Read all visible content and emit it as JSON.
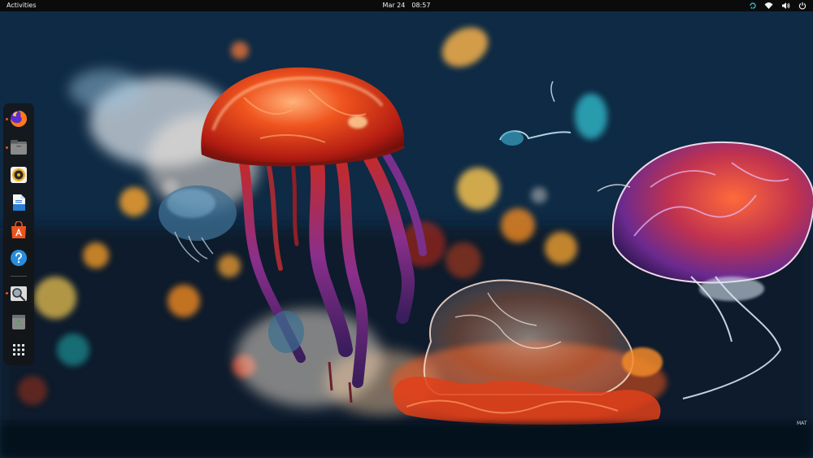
{
  "topbar": {
    "activities_label": "Activities",
    "date": "Mar 24",
    "time": "08:57",
    "tray_icons": [
      "updates-icon",
      "network-icon",
      "volume-icon",
      "power-icon"
    ]
  },
  "dock": {
    "items": [
      {
        "name": "Firefox",
        "icon": "firefox-icon",
        "running": true
      },
      {
        "name": "Files",
        "icon": "files-icon",
        "running": true
      },
      {
        "name": "Rhythmbox",
        "icon": "rhythmbox-icon",
        "running": false
      },
      {
        "name": "LibreOffice Writer",
        "icon": "writer-icon",
        "running": false
      },
      {
        "name": "Ubuntu Software",
        "icon": "software-icon",
        "running": false
      },
      {
        "name": "Help",
        "icon": "help-icon",
        "running": false
      },
      {
        "name": "Image Viewer",
        "icon": "image-viewer-icon",
        "running": true
      },
      {
        "name": "Trash",
        "icon": "trash-icon",
        "running": false
      },
      {
        "name": "Show Applications",
        "icon": "app-grid-icon",
        "running": false
      }
    ]
  },
  "colors": {
    "accent": "#e95420",
    "topbar_bg": "#0b0b0b",
    "dock_bg": "#141414"
  },
  "wallpaper": {
    "signature": "MAT"
  }
}
